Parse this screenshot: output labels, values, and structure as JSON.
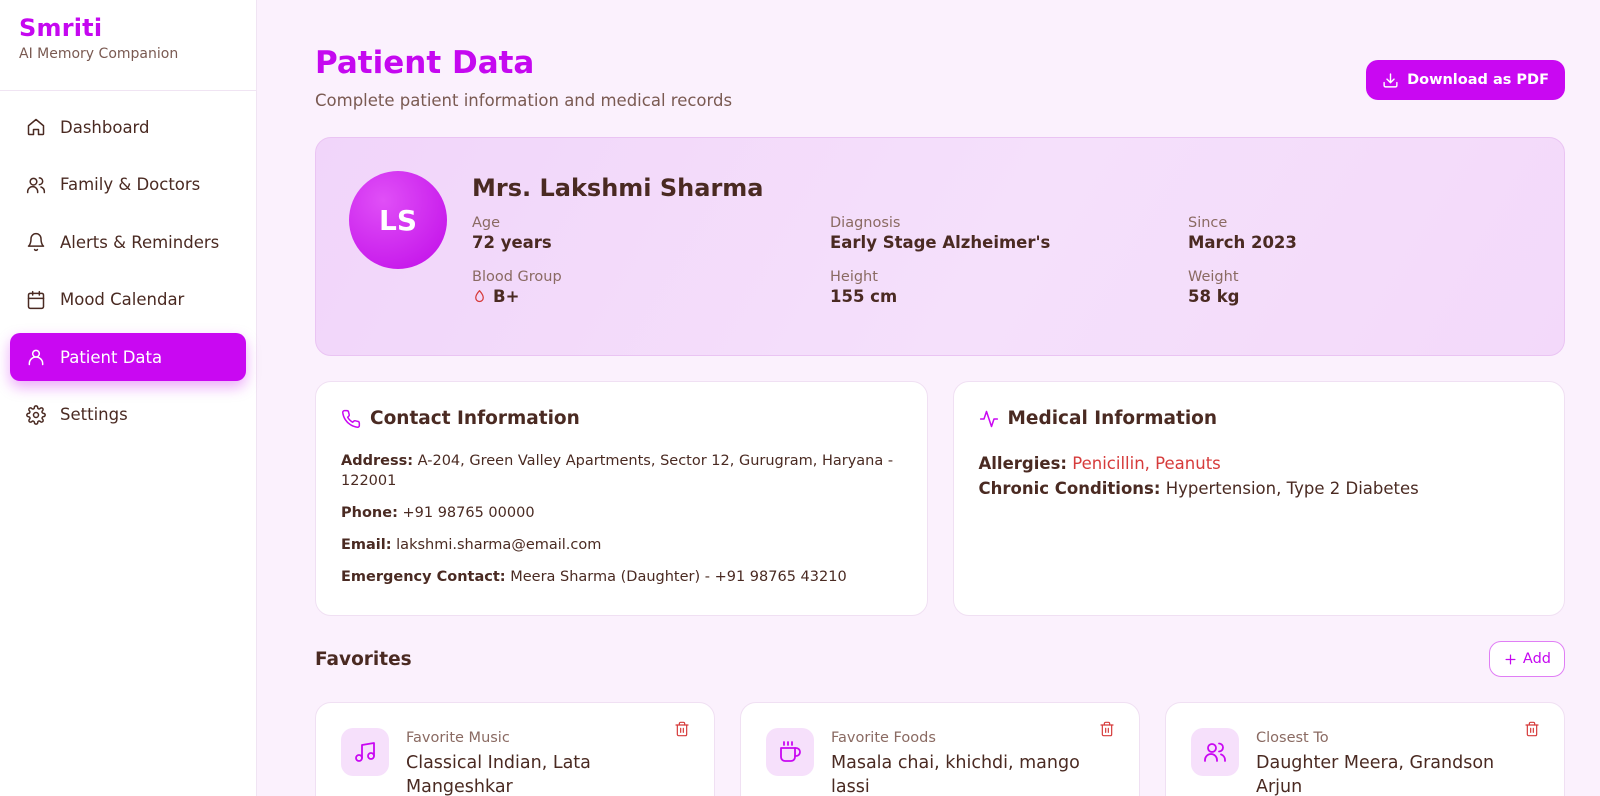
{
  "app": {
    "name": "Smriti",
    "tagline": "AI Memory Companion"
  },
  "sidebar": {
    "items": [
      {
        "label": "Dashboard",
        "icon": "home-icon"
      },
      {
        "label": "Family & Doctors",
        "icon": "users-icon"
      },
      {
        "label": "Alerts & Reminders",
        "icon": "bell-icon"
      },
      {
        "label": "Mood Calendar",
        "icon": "calendar-icon"
      },
      {
        "label": "Patient Data",
        "icon": "user-icon",
        "active": true
      },
      {
        "label": "Settings",
        "icon": "gear-icon"
      }
    ]
  },
  "header": {
    "title": "Patient Data",
    "subtitle": "Complete patient information and medical records",
    "download_label": "Download as PDF"
  },
  "patient": {
    "initials": "LS",
    "name": "Mrs. Lakshmi Sharma",
    "fields": {
      "age": {
        "label": "Age",
        "value": "72 years"
      },
      "diagnosis": {
        "label": "Diagnosis",
        "value": "Early Stage Alzheimer's"
      },
      "since": {
        "label": "Since",
        "value": "March 2023"
      },
      "blood": {
        "label": "Blood Group",
        "value": "B+"
      },
      "height": {
        "label": "Height",
        "value": "155 cm"
      },
      "weight": {
        "label": "Weight",
        "value": "58 kg"
      }
    }
  },
  "contact": {
    "title": "Contact Information",
    "address_label": "Address:",
    "address": "A-204, Green Valley Apartments, Sector 12, Gurugram, Haryana - 122001",
    "phone_label": "Phone:",
    "phone": "+91 98765 00000",
    "email_label": "Email:",
    "email": "lakshmi.sharma@email.com",
    "emergency_label": "Emergency Contact:",
    "emergency": "Meera Sharma (Daughter) - +91 98765 43210"
  },
  "medical": {
    "title": "Medical Information",
    "allergies_label": "Allergies:",
    "allergies": "Penicillin, Peanuts",
    "chronic_label": "Chronic Conditions:",
    "chronic": "Hypertension, Type 2 Diabetes"
  },
  "favorites": {
    "title": "Favorites",
    "add_label": "Add",
    "items": [
      {
        "label": "Favorite Music",
        "value": "Classical Indian, Lata Mangeshkar",
        "icon": "music-icon"
      },
      {
        "label": "Favorite Foods",
        "value": "Masala chai, khichdi, mango lassi",
        "icon": "coffee-icon"
      },
      {
        "label": "Closest To",
        "value": "Daughter Meera, Grandson Arjun",
        "icon": "people-icon"
      }
    ]
  },
  "colors": {
    "accent": "#c908f2",
    "text": "#4a2a22",
    "allergy": "#d63b3b",
    "background": "#fbf1fd"
  }
}
